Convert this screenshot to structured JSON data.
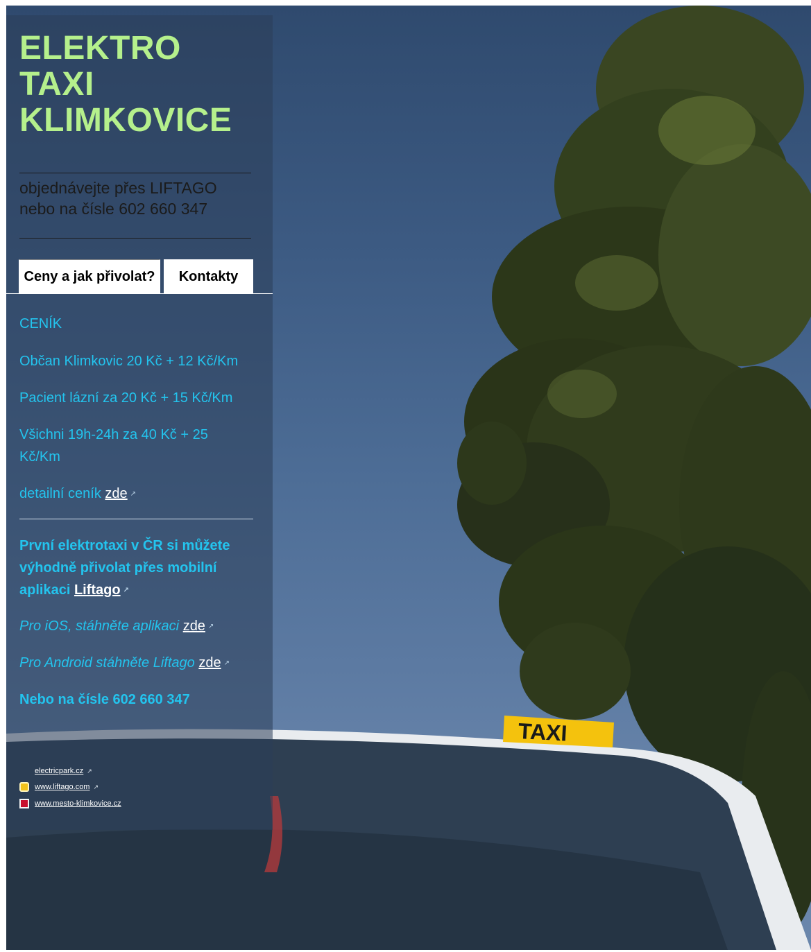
{
  "site": {
    "title_lines": [
      "ELEKTRO",
      "TAXI",
      "KLIMKOVICE"
    ],
    "order_lines": [
      "objednávejte přes LIFTAGO",
      "nebo na čísle 602 660 347"
    ]
  },
  "tabs": [
    {
      "label": "Ceny a jak přivolat?",
      "active": true
    },
    {
      "label": "Kontakty",
      "active": false
    }
  ],
  "pricing": {
    "heading": "CENÍK",
    "items": [
      "Občan Klimkovic 20 Kč + 12 Kč/Km",
      "Pacient lázní za 20 Kč + 15 Kč/Km",
      "Všichni 19h-24h za 40 Kč + 25 Kč/Km"
    ],
    "detail_prefix": "detailní ceník",
    "detail_link": "zde"
  },
  "app": {
    "promo_text": "První elektrotaxi v ČR si můžete výhodně přivolat přes mobilní aplikaci",
    "promo_link": "Liftago",
    "ios_text": "Pro iOS, stáhněte aplikaci",
    "ios_link": "zde",
    "android_text": "Pro Android stáhněte Liftago",
    "android_link": "zde",
    "phone_text": "Nebo na čísle 602 660 347"
  },
  "footer_links": [
    {
      "label": "electricpark.cz",
      "icon": "none"
    },
    {
      "label": "www.liftago.com",
      "icon": "liftago-icon"
    },
    {
      "label": "www.mesto-klimkovice.cz",
      "icon": "klimkovice-crest-icon"
    }
  ],
  "background": {
    "sign_text": "TAXI",
    "colors": {
      "sky": "#4d6d96",
      "tree": "#2f3a1e",
      "car": "#f2f2f2",
      "sign": "#f4c20d",
      "title": "#b5f08c",
      "accent": "#23c4ee"
    }
  }
}
